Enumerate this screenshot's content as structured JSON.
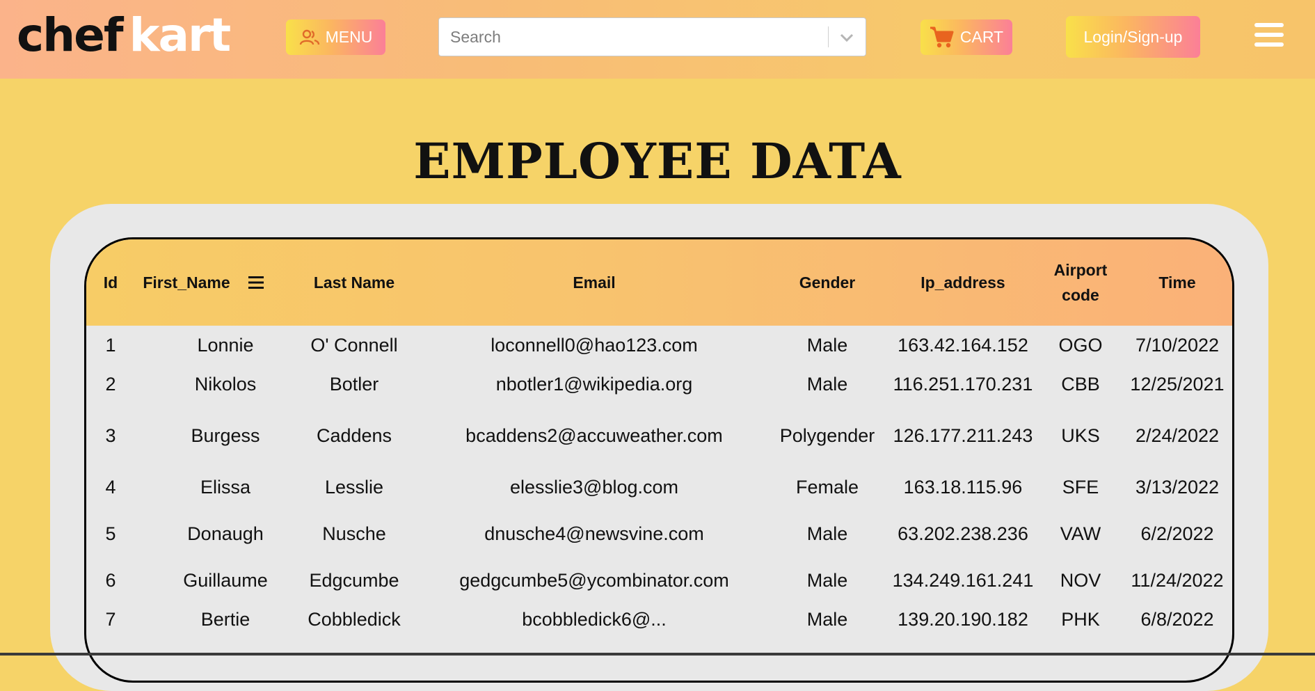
{
  "brand": {
    "logo_part1": "chef",
    "logo_part2": "kart"
  },
  "nav": {
    "menu_label": "MENU",
    "search_placeholder": "Search",
    "cart_label": "CART",
    "login_label": "Login/Sign-up"
  },
  "page": {
    "title": "EMPLOYEE DATA"
  },
  "table": {
    "headers": [
      "Id",
      "First_Name",
      "Last Name",
      "Email",
      "Gender",
      "Ip_address",
      "Airport code",
      "Time"
    ],
    "rows": [
      [
        "1",
        "Lonnie",
        "O' Connell",
        "loconnell0@hao123.com",
        "Male",
        "163.42.164.152",
        "OGO",
        "7/10/2022"
      ],
      [
        "2",
        "Nikolos",
        "Botler",
        "nbotler1@wikipedia.org",
        "Male",
        "116.251.170.231",
        "CBB",
        "12/25/2021"
      ],
      [
        "3",
        "Burgess",
        "Caddens",
        "bcaddens2@accuweather.com",
        "Polygender",
        "126.177.211.243",
        "UKS",
        "2/24/2022"
      ],
      [
        "4",
        "Elissa",
        "Lesslie",
        "elesslie3@blog.com",
        "Female",
        "163.18.115.96",
        "SFE",
        "3/13/2022"
      ],
      [
        "5",
        "Donaugh",
        "Nusche",
        "dnusche4@newsvine.com",
        "Male",
        "63.202.238.236",
        "VAW",
        "6/2/2022"
      ],
      [
        "6",
        "Guillaume",
        "Edgcumbe",
        "gedgcumbe5@ycombinator.com",
        "Male",
        "134.249.161.241",
        "NOV",
        "11/24/2022"
      ],
      [
        "7",
        "Bertie",
        "Cobbledick",
        "bcobbledick6@...",
        "Male",
        "139.20.190.182",
        "PHK",
        "6/8/2022"
      ]
    ]
  },
  "colors": {
    "background": "#f6d368",
    "button_gradient_start": "#f9e04a",
    "button_gradient_end": "#fb7f97",
    "panel": "#e8e8e8"
  },
  "icons": {
    "menu": "users-icon",
    "cart": "cart-icon",
    "sort": "bars-icon",
    "nav": "hamburger-icon",
    "dropdown": "chevron-down-icon"
  }
}
